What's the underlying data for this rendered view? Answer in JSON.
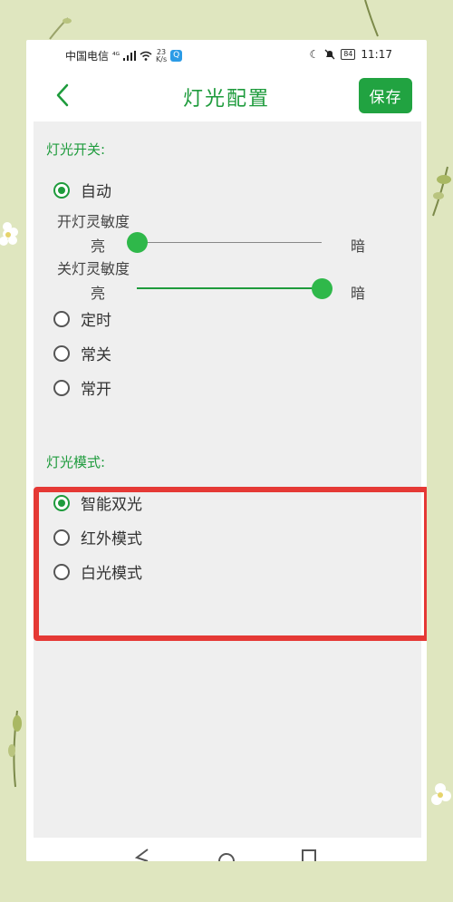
{
  "status_bar": {
    "carrier": "中国电信",
    "signal_label": "⁴ᴳ",
    "net_speed_value": "23",
    "net_speed_unit": "K/s",
    "app_badge": "Q",
    "battery": "84",
    "time": "11:17"
  },
  "header": {
    "title": "灯光配置",
    "save_label": "保存"
  },
  "light_switch": {
    "label": "灯光开关:",
    "options": [
      {
        "label": "自动",
        "checked": true
      },
      {
        "label": "定时",
        "checked": false
      },
      {
        "label": "常关",
        "checked": false
      },
      {
        "label": "常开",
        "checked": false
      }
    ],
    "on_sensitivity": {
      "label": "开灯灵敏度",
      "min_label": "亮",
      "max_label": "暗",
      "value": 0.0
    },
    "off_sensitivity": {
      "label": "关灯灵敏度",
      "min_label": "亮",
      "max_label": "暗",
      "value": 1.0
    }
  },
  "light_mode": {
    "label": "灯光模式:",
    "options": [
      {
        "label": "智能双光",
        "checked": true
      },
      {
        "label": "红外模式",
        "checked": false
      },
      {
        "label": "白光模式",
        "checked": false
      }
    ]
  },
  "colors": {
    "accent": "#1e9b3c",
    "button": "#21a341",
    "highlight": "#e53935",
    "background": "#dfe6bf"
  }
}
